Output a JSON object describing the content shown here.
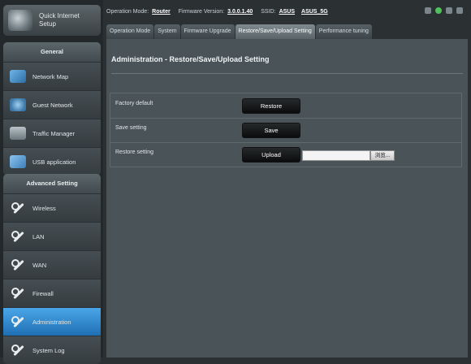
{
  "quick_setup": {
    "label_line1": "Quick Internet",
    "label_line2": "Setup"
  },
  "sidebar": {
    "general_header": "General",
    "general_items": [
      {
        "label": "Network Map",
        "icon": "network-map-icon"
      },
      {
        "label": "Guest Network",
        "icon": "guest-network-icon"
      },
      {
        "label": "Traffic Manager",
        "icon": "traffic-manager-icon"
      },
      {
        "label": "USB application",
        "icon": "usb-icon"
      }
    ],
    "advanced_header": "Advanced Setting",
    "advanced_items": [
      {
        "label": "Wireless",
        "icon": "wrench-icon"
      },
      {
        "label": "LAN",
        "icon": "wrench-icon"
      },
      {
        "label": "WAN",
        "icon": "wrench-icon"
      },
      {
        "label": "Firewall",
        "icon": "wrench-icon"
      },
      {
        "label": "Administration",
        "icon": "wrench-icon",
        "active": true
      },
      {
        "label": "System Log",
        "icon": "wrench-icon"
      }
    ]
  },
  "status": {
    "op_mode_label": "Operation Mode:",
    "op_mode_value": "Router",
    "firmware_label": "Firmware Version:",
    "firmware_value": "3.0.0.1.40",
    "ssid_label": "SSID:",
    "ssid_value1": "ASUS",
    "ssid_value2": "ASUS_5G"
  },
  "tabs": [
    {
      "label": "Operation Mode"
    },
    {
      "label": "System"
    },
    {
      "label": "Firmware Upgrade"
    },
    {
      "label": "Restore/Save/Upload Setting",
      "active": true
    },
    {
      "label": "Performance tuning"
    }
  ],
  "main": {
    "title": "Administration - Restore/Save/Upload Setting",
    "rows": [
      {
        "label": "Factory default",
        "button": "Restore"
      },
      {
        "label": "Save setting",
        "button": "Save"
      },
      {
        "label": "Restore setting",
        "button": "Upload",
        "file_value": "",
        "browse": "浏览..."
      }
    ]
  },
  "colors": {
    "accent": "#2b80c4",
    "bg": "#2b3033",
    "panel": "#4a5357"
  }
}
